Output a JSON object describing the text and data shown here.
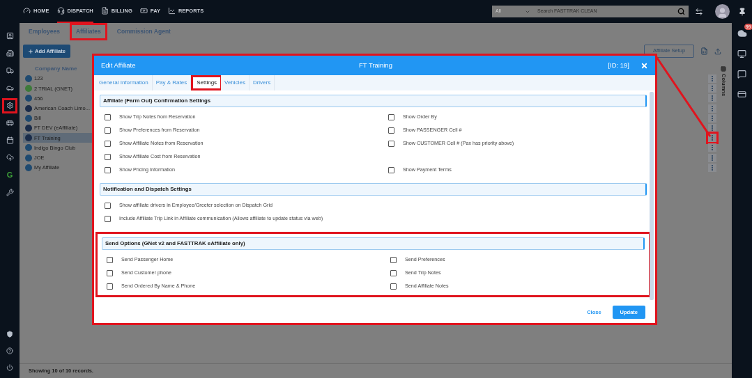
{
  "top_nav": {
    "items": [
      {
        "label": "HOME",
        "selected": false
      },
      {
        "label": "DISPATCH",
        "selected": true
      },
      {
        "label": "BILLING",
        "selected": false
      },
      {
        "label": "PAY",
        "selected": false
      },
      {
        "label": "REPORTS",
        "selected": false
      }
    ],
    "search": {
      "scope": "All",
      "placeholder": "Search FASTTRAK CLEAN"
    }
  },
  "left_sidebar": {
    "items": [
      {
        "annotated": false
      },
      {
        "annotated": false
      },
      {
        "annotated": false
      },
      {
        "annotated": false
      },
      {
        "annotated": true
      },
      {
        "annotated": false
      },
      {
        "annotated": false
      },
      {
        "annotated": false
      },
      {
        "annotated": false,
        "text": "G"
      },
      {
        "annotated": false
      }
    ]
  },
  "right_sidebar": {
    "badge": "99"
  },
  "page_tabs": [
    {
      "label": "Employees",
      "annotated": false
    },
    {
      "label": "Affiliates",
      "annotated": true
    },
    {
      "label": "Commission Agent",
      "annotated": false
    }
  ],
  "add_button": "Add Affiliate",
  "setup_button": "Affiliate Setup",
  "columns_tab": "Columns",
  "table": {
    "column": "Company Name",
    "rows": [
      {
        "name": "123",
        "color": "#1f4a70",
        "selected": false,
        "annotated": false
      },
      {
        "name": "2 TRIAL (GNET)",
        "color": "#3d7a3a",
        "selected": false,
        "annotated": false
      },
      {
        "name": "456",
        "color": "#1f4a70",
        "selected": false,
        "annotated": false
      },
      {
        "name": "American Coach Limo...",
        "color": "#1a2c4a",
        "selected": false,
        "annotated": false
      },
      {
        "name": "Bill",
        "color": "#1f4a70",
        "selected": false,
        "annotated": false
      },
      {
        "name": "FT DEV (eAffiliate)",
        "color": "#1a2c4a",
        "selected": false,
        "annotated": false
      },
      {
        "name": "FT Training",
        "color": "#1a2c4a",
        "selected": true,
        "annotated": true
      },
      {
        "name": "Indigo Bingo Club",
        "color": "#1f4a70",
        "selected": false,
        "annotated": false
      },
      {
        "name": "JOE",
        "color": "#1f4a70",
        "selected": false,
        "annotated": false
      },
      {
        "name": "My Affiliate",
        "color": "#1f4a70",
        "selected": false,
        "annotated": false
      }
    ]
  },
  "footer": "Showing 10 of 10 records.",
  "modal": {
    "title": "Edit Affiliate",
    "subtitle": "FT Training",
    "id": "[ID: 19]",
    "annotated": true,
    "tabs": [
      {
        "label": "General Information",
        "selected": false,
        "annotated": false
      },
      {
        "label": "Pay & Rates",
        "selected": false,
        "annotated": false
      },
      {
        "label": "Settings",
        "selected": true,
        "annotated": true
      },
      {
        "label": "Vehicles",
        "selected": false,
        "annotated": false
      },
      {
        "label": "Drivers",
        "selected": false,
        "annotated": false
      }
    ],
    "sections": [
      {
        "title": "Affiliate (Farm Out) Confirmation Settings",
        "annotated": false,
        "rows": [
          [
            {
              "label": "Show Trip Notes from Reservation",
              "checked": false
            },
            {
              "label": "Show Order By",
              "checked": false
            }
          ],
          [
            {
              "label": "Show Preferences from Reservation",
              "checked": false
            },
            {
              "label": "Show PASSENGER Cell #",
              "checked": false
            }
          ],
          [
            {
              "label": "Show Affiliate Notes from Reservation",
              "checked": false
            },
            {
              "label": "Show CUSTOMER Cell # (Pax has priority above)",
              "checked": false
            }
          ],
          [
            {
              "label": "Show Affiliate Cost from Reservation",
              "checked": false
            }
          ],
          [
            {
              "label": "Show Pricing Information",
              "checked": false
            },
            {
              "label": "Show Payment Terms",
              "checked": false
            }
          ]
        ]
      },
      {
        "title": "Notification and Dispatch Settings",
        "annotated": false,
        "rows": [
          [
            {
              "label": "Show affiliate drivers in Employee/Greeter selection on Dispatch Grid",
              "checked": false
            }
          ],
          [
            {
              "label": "Include Affiliate Trip Link in Affiliate communication (Allows affiliate to update status via web)",
              "checked": false
            }
          ]
        ]
      },
      {
        "title": "Send Options (GNet v2 and FASTTRAK eAffiliate only)",
        "annotated": true,
        "rows": [
          [
            {
              "label": "Send Passenger Home",
              "checked": false
            },
            {
              "label": "Send Preferences",
              "checked": false
            }
          ],
          [
            {
              "label": "Send Customer phone",
              "checked": false
            },
            {
              "label": "Send Trip Notes",
              "checked": false
            }
          ],
          [
            {
              "label": "Send Ordered By Name & Phone",
              "checked": false
            },
            {
              "label": "Send Affiliate Notes",
              "checked": false
            }
          ]
        ]
      }
    ],
    "close_button": "Close",
    "update_button": "Update"
  }
}
